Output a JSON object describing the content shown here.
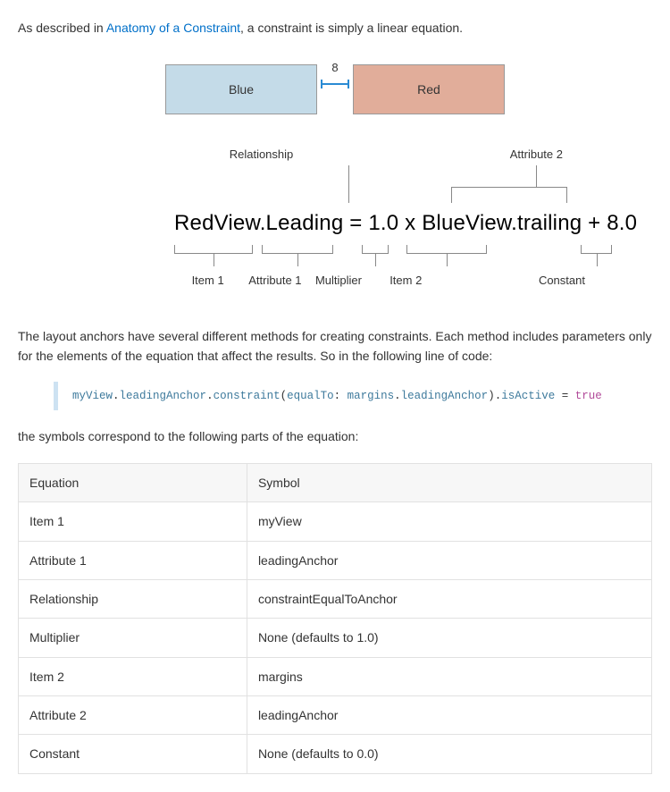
{
  "intro": {
    "prefix": "As described in ",
    "link_text": "Anatomy of a Constraint",
    "suffix": ", a constraint is simply a linear equation."
  },
  "diagram": {
    "blue_label": "Blue",
    "red_label": "Red",
    "gap_value": "8",
    "top_labels": {
      "relationship": "Relationship",
      "attribute2": "Attribute 2"
    },
    "equation": "RedView.Leading = 1.0 x BlueView.trailing + 8.0",
    "bottom_labels": {
      "item1": "Item 1",
      "attribute1": "Attribute 1",
      "multiplier": "Multiplier",
      "item2": "Item 2",
      "constant": "Constant"
    }
  },
  "mid_p1": "The layout anchors have several different methods for creating constraints. Each method includes parameters only for the elements of the equation that affect the results. So in the following line of code:",
  "code": {
    "s1": "myView",
    "s2": "leadingAnchor",
    "s3": "constraint",
    "s4": "equalTo",
    "s5": "margins",
    "s6": "leadingAnchor",
    "s7": "isActive",
    "s8": "true"
  },
  "mid_p2": "the symbols correspond to the following parts of the equation:",
  "table": {
    "headers": [
      "Equation",
      "Symbol"
    ],
    "rows": [
      [
        "Item 1",
        "myView"
      ],
      [
        "Attribute 1",
        "leadingAnchor"
      ],
      [
        "Relationship",
        "constraintEqualToAnchor"
      ],
      [
        "Multiplier",
        "None (defaults to 1.0)"
      ],
      [
        "Item 2",
        "margins"
      ],
      [
        "Attribute 2",
        "leadingAnchor"
      ],
      [
        "Constant",
        "None (defaults to 0.0)"
      ]
    ]
  }
}
